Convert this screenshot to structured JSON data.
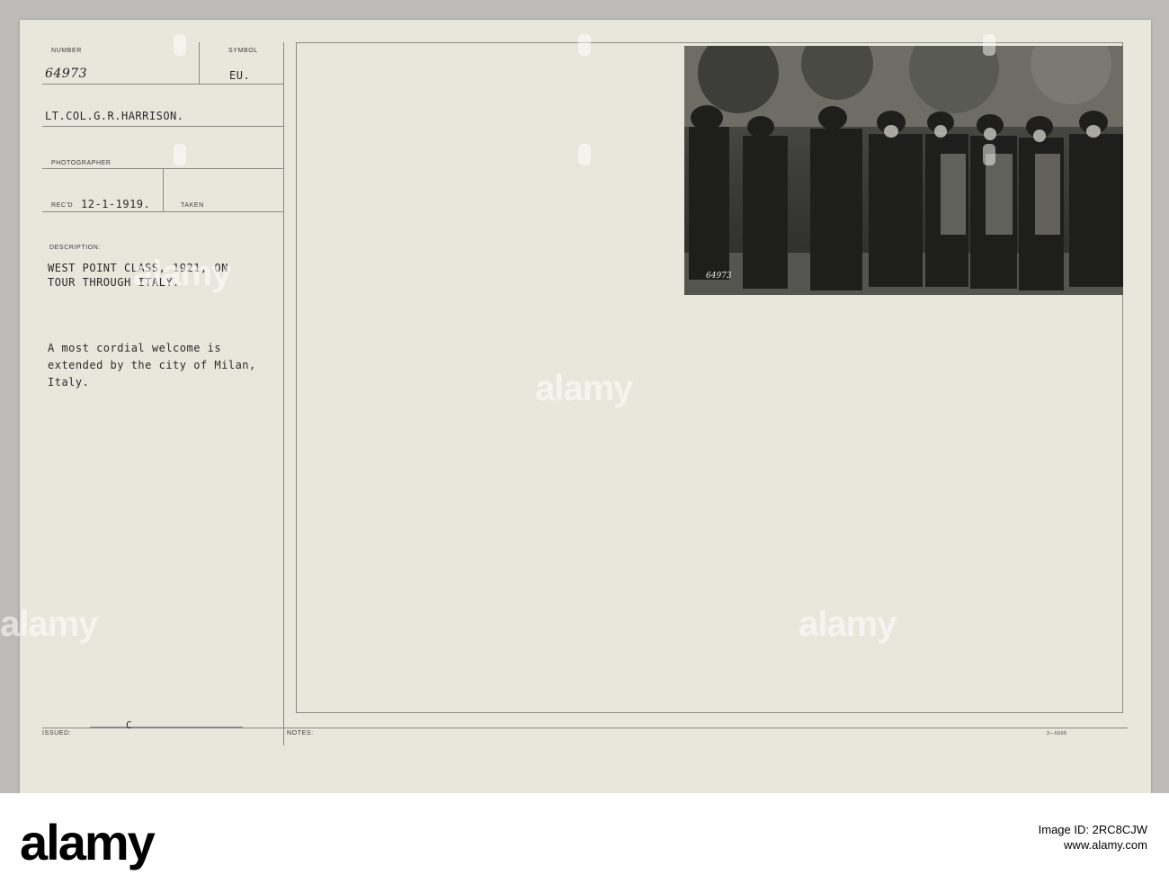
{
  "card": {
    "number_label": "NUMBER",
    "number_value": "64973",
    "symbol_label": "SYMBOL",
    "symbol_value": "EU.",
    "photographer_name": "LT.COL.G.R.HARRISON.",
    "photographer_label": "PHOTOGRAPHER",
    "recd_label": "REC'D",
    "recd_value": "12-1-1919.",
    "taken_label": "TAKEN",
    "description_label": "DESCRIPTION:",
    "description_title": [
      "WEST POINT CLASS, 1921, ON",
      "TOUR THROUGH ITALY."
    ],
    "description_text": [
      "A most cordial welcome is",
      "extended by the city of Milan,",
      "Italy."
    ],
    "issued_label": "ISSUED:",
    "issued_value": "C",
    "notes_label": "NOTES:",
    "form_code": "3—5605"
  },
  "photo": {
    "negative_number": "64973"
  },
  "watermark": {
    "text": "alamy"
  },
  "footer": {
    "logo": "alamy",
    "image_id": "Image ID: 2RC8CJW",
    "site": "www.alamy.com"
  }
}
